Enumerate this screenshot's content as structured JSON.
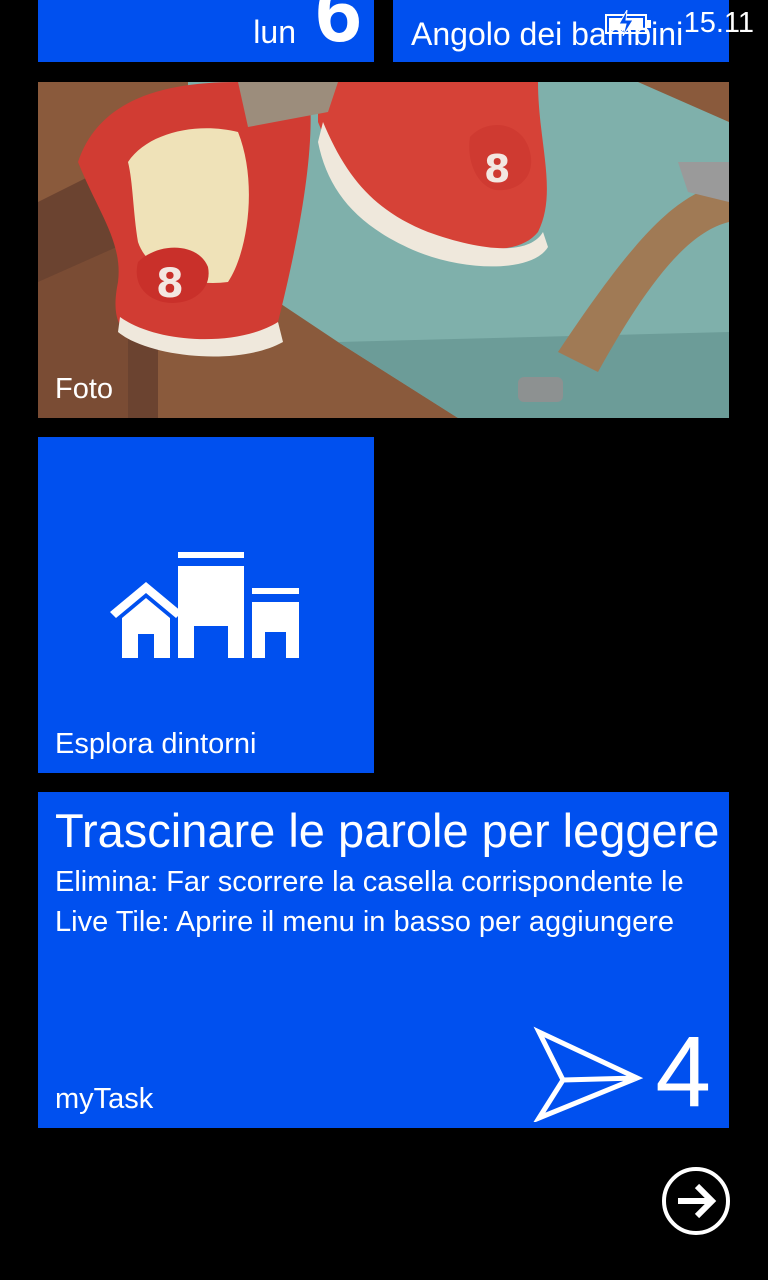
{
  "status_bar": {
    "time": "15.11",
    "battery_icon": "battery-charging-icon"
  },
  "tiles": {
    "calendar": {
      "day": "lun",
      "date": "6"
    },
    "kids_corner": {
      "label": "Angolo dei bambini"
    },
    "photos": {
      "label": "Foto"
    },
    "explore": {
      "label": "Esplora dintorni",
      "icon": "buildings-icon"
    },
    "mytask": {
      "title": "Trascinare le parole per leggere",
      "line1": "Elimina: Far scorrere la casella corrispondente le",
      "line2": "Live Tile: Aprire il menu in basso per aggiungere",
      "label": "myTask",
      "count": "4",
      "icon": "send-arrow-icon"
    }
  },
  "all_apps": {
    "icon": "arrow-right-circle-icon"
  },
  "colors": {
    "accent": "#0050ef",
    "background": "#000000"
  }
}
